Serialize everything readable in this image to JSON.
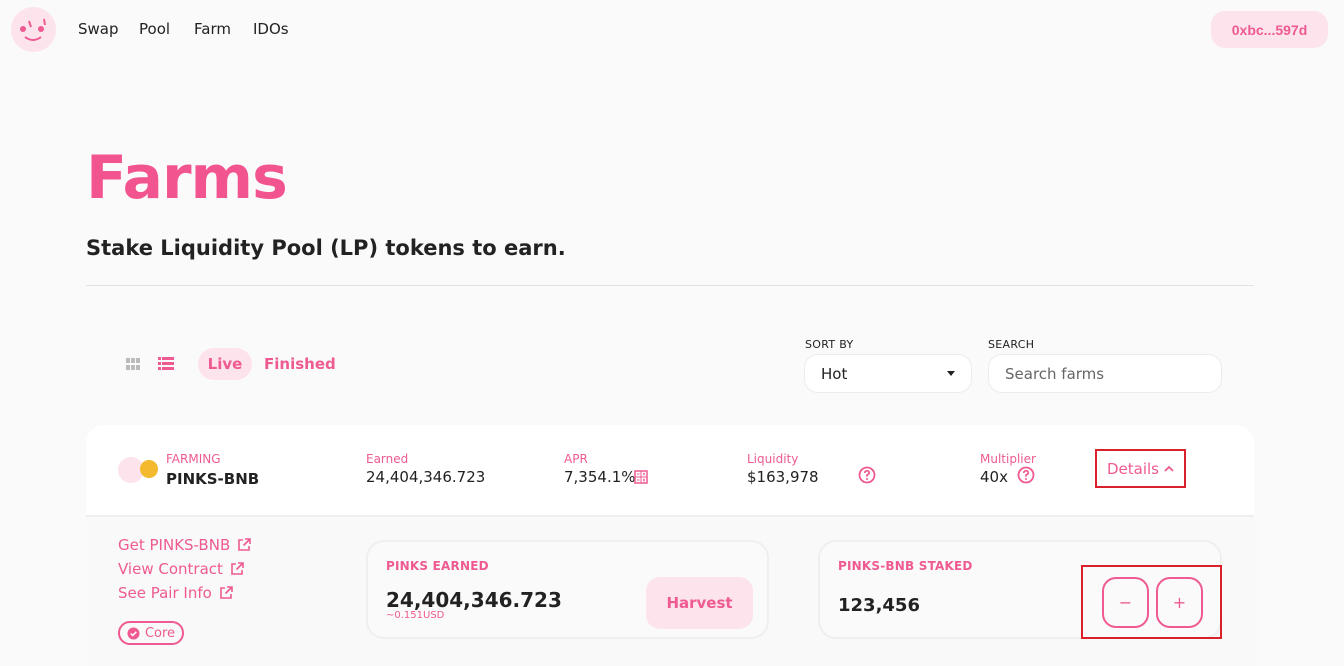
{
  "nav": {
    "links": [
      "Swap",
      "Pool",
      "Farm",
      "IDOs"
    ],
    "wallet": "0xbc...597d"
  },
  "hero": {
    "title": "Farms",
    "subtitle": "Stake Liquidity Pool (LP) tokens to earn."
  },
  "controls": {
    "tabs": {
      "live": "Live",
      "finished": "Finished"
    },
    "sort_label": "SORT BY",
    "sort_value": "Hot",
    "search_label": "SEARCH",
    "search_placeholder": "Search farms"
  },
  "farm": {
    "farming_label": "FARMING",
    "pair": "PINKS-BNB",
    "earned_label": "Earned",
    "earned": "24,404,346.723",
    "apr_label": "APR",
    "apr": "7,354.1%",
    "liquidity_label": "Liquidity",
    "liquidity": "$163,978",
    "multiplier_label": "Multiplier",
    "multiplier": "40x",
    "details_label": "Details"
  },
  "expanded": {
    "links": [
      "Get PINKS-BNB",
      "View Contract",
      "See Pair Info"
    ],
    "badge": "Core",
    "earned_panel": {
      "title": "PINKS EARNED",
      "value": "24,404,346.723",
      "usd": "~0.151USD",
      "harvest_label": "Harvest"
    },
    "staked_panel": {
      "title": "PINKS-BNB STAKED",
      "value": "123,456",
      "minus_label": "−",
      "plus_label": "+"
    }
  },
  "colors": {
    "accent": "#ee5a91",
    "accent_soft": "#fde3ec",
    "highlight": "#d9202b"
  }
}
